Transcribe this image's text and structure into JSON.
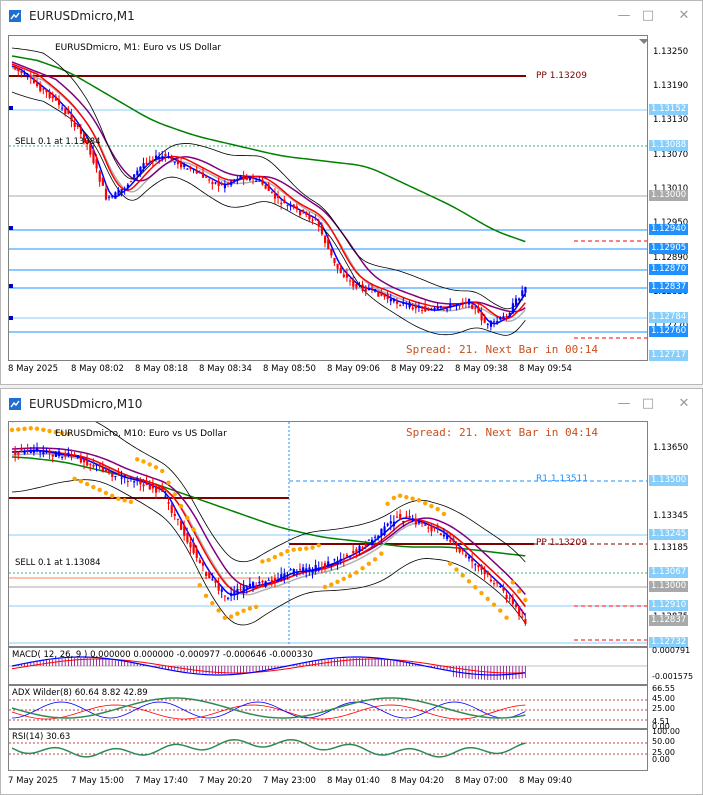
{
  "colors": {
    "accent": "#0000ff",
    "pp": "#800000",
    "spread": "#c8501e",
    "r1": "#1e90ff",
    "ma_green": "#008000",
    "ma_red": "#ff0000",
    "ma_purple": "#800080",
    "bb": "#000000",
    "psar": "#ffa500"
  },
  "window1": {
    "title": "EURUSDmicro,M1",
    "chart_header": "EURUSDmicro, M1:  Euro vs US Dollar",
    "pp_label": "PP 1.13209",
    "sell_label": "SELL 0.1 at 1.13084",
    "spread_text": "Spread: 21. Next Bar in 00:14",
    "y_ticks": [
      "1.13250",
      "1.13190",
      "1.13130",
      "1.13070",
      "1.13010",
      "1.12950",
      "1.12890",
      "1.12830",
      "1.12770"
    ],
    "price_tags": [
      {
        "text": "1.13152",
        "bg": "#87cefa",
        "fg": "#ffffff"
      },
      {
        "text": "1.13088",
        "bg": "#87cefa",
        "fg": "#ffffff"
      },
      {
        "text": "1.13000",
        "bg": "#a9a9a9",
        "fg": "#ffffff"
      },
      {
        "text": "1.12940",
        "bg": "#1e90ff",
        "fg": "#ffffff"
      },
      {
        "text": "1.12905",
        "bg": "#1e90ff",
        "fg": "#ffffff"
      },
      {
        "text": "1.12870",
        "bg": "#1e90ff",
        "fg": "#ffffff"
      },
      {
        "text": "1.12837",
        "bg": "#1e90ff",
        "fg": "#ffffff"
      },
      {
        "text": "1.12784",
        "bg": "#87cefa",
        "fg": "#ffffff"
      },
      {
        "text": "1.12760",
        "bg": "#1e90ff",
        "fg": "#ffffff"
      },
      {
        "text": "1.12717",
        "bg": "#87cefa",
        "fg": "#ffffff"
      }
    ],
    "x_ticks": [
      "8 May 2025",
      "8 May 08:02",
      "8 May 08:18",
      "8 May 08:34",
      "8 May 08:50",
      "8 May 09:06",
      "8 May 09:22",
      "8 May 09:38",
      "8 May 09:54"
    ]
  },
  "window2": {
    "title": "EURUSDmicro,M10",
    "chart_header": "EURUSDmicro, M10:  Euro vs US Dollar",
    "spread_text": "Spread: 21. Next Bar in 04:14",
    "r1_label": "R1 1.13511",
    "pp_label": "PP 1.13209",
    "sell_label": "SELL 0.1 at 1.13084",
    "y_ticks": [
      "1.13650",
      "1.13345",
      "1.13185",
      "1.12875"
    ],
    "price_tags": [
      {
        "text": "1.13500",
        "bg": "#87cefa",
        "fg": "#ffffff"
      },
      {
        "text": "1.13245",
        "bg": "#87cefa",
        "fg": "#ffffff"
      },
      {
        "text": "1.13067",
        "bg": "#87cefa",
        "fg": "#ffffff"
      },
      {
        "text": "1.13000",
        "bg": "#a9a9a9",
        "fg": "#ffffff"
      },
      {
        "text": "1.12910",
        "bg": "#87cefa",
        "fg": "#ffffff"
      },
      {
        "text": "1.12837",
        "bg": "#a9a9a9",
        "fg": "#ffffff"
      },
      {
        "text": "1.12732",
        "bg": "#87cefa",
        "fg": "#ffffff"
      }
    ],
    "macd_label": "MACD( 12, 26, 9 ) 0.000000 0.000000 -0.000977 -0.000646 -0.000330",
    "macd_ticks": [
      "0.000791",
      "-0.001575"
    ],
    "adx_label": "ADX Wilder(8) 60.64 8.82 42.89",
    "adx_ticks": [
      "66.55",
      "45.00",
      "25.00",
      "4.51",
      "0.00"
    ],
    "rsi_label": "RSI(14) 30.63",
    "rsi_ticks": [
      "100.00",
      "50.00",
      "25.00",
      "0.00"
    ],
    "x_ticks": [
      "7 May 2025",
      "7 May 15:00",
      "7 May 17:40",
      "7 May 20:20",
      "7 May 23:00",
      "8 May 01:40",
      "8 May 04:20",
      "8 May 07:00",
      "8 May 09:40"
    ]
  }
}
